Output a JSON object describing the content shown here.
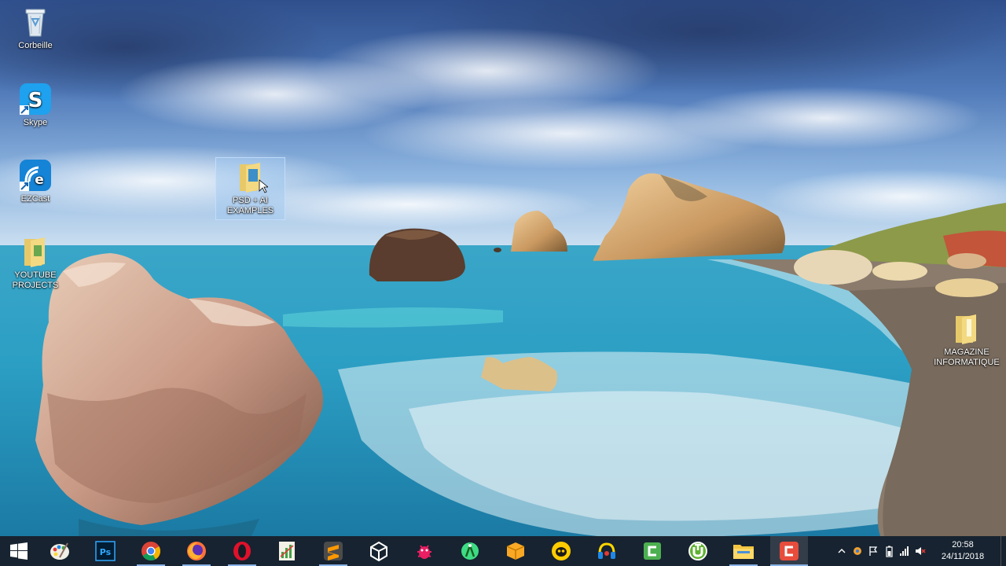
{
  "desktop": {
    "icons": [
      {
        "id": "recycle-bin",
        "label": "Corbeille",
        "icon": "recycle-bin-icon"
      },
      {
        "id": "skype",
        "label": "Skype",
        "icon": "skype-icon"
      },
      {
        "id": "ezcast",
        "label": "EZCast",
        "icon": "ezcast-icon"
      },
      {
        "id": "youtube-projects",
        "label": "YOUTUBE PROJECTS",
        "icon": "folder-icon"
      },
      {
        "id": "psd-ai-examples",
        "label": "PSD + AI EXAMPLES",
        "icon": "folder-icon",
        "selected": true
      },
      {
        "id": "magazine-informatique",
        "label": "MAGAZINE INFORMATIQUE",
        "icon": "folder-icon"
      }
    ]
  },
  "taskbar": {
    "items": [
      {
        "id": "start",
        "icon": "windows-logo-icon"
      },
      {
        "id": "paint",
        "icon": "paint-palette-icon"
      },
      {
        "id": "photoshop",
        "icon": "photoshop-icon",
        "text": "Ps"
      },
      {
        "id": "chrome",
        "icon": "chrome-icon"
      },
      {
        "id": "firefox",
        "icon": "firefox-icon"
      },
      {
        "id": "opera",
        "icon": "opera-icon"
      },
      {
        "id": "chart-app",
        "icon": "spreadsheet-chart-icon"
      },
      {
        "id": "sublime",
        "icon": "sublime-text-icon"
      },
      {
        "id": "unity",
        "icon": "unity-icon"
      },
      {
        "id": "android-bug",
        "icon": "android-bug-icon"
      },
      {
        "id": "android-studio",
        "icon": "android-studio-icon"
      },
      {
        "id": "package",
        "icon": "package-box-icon"
      },
      {
        "id": "cyberghost",
        "icon": "ghost-vpn-icon"
      },
      {
        "id": "headset-app",
        "icon": "headset-icon"
      },
      {
        "id": "camtasia",
        "icon": "camtasia-icon"
      },
      {
        "id": "utorrent",
        "icon": "utorrent-icon"
      },
      {
        "id": "file-explorer",
        "icon": "folder-explorer-icon"
      },
      {
        "id": "camtasia-recorder",
        "icon": "camtasia-recorder-icon"
      }
    ],
    "tray": {
      "icons": [
        "chevron-up-icon",
        "network-icon",
        "flag-icon",
        "battery-icon",
        "signal-icon",
        "volume-muted-icon"
      ],
      "time": "20:58",
      "date": "24/11/2018"
    }
  },
  "colors": {
    "taskbar_bg": "#161c26",
    "accent": "#8ab4e8"
  }
}
